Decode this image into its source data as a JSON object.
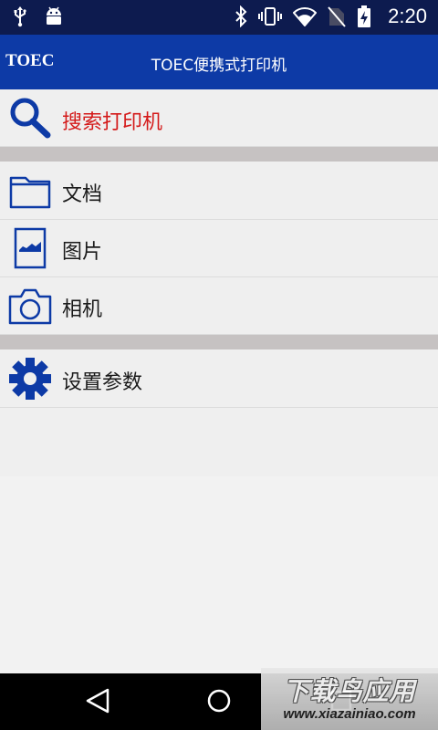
{
  "status_bar": {
    "time": "2:20",
    "left_icons": [
      "usb-icon",
      "android-icon"
    ],
    "right_icons": [
      "bluetooth-icon",
      "vibrate-icon",
      "wifi-icon",
      "no-sim-icon",
      "battery-charging-icon"
    ]
  },
  "app_bar": {
    "logo": "TOEC",
    "title": "TOEC便携式打印机",
    "color": "#0d3aa6"
  },
  "menu": {
    "search": {
      "label": "搜索打印机",
      "icon": "search-icon",
      "color": "#d41a1a"
    },
    "items": [
      {
        "label": "文档",
        "icon": "folder-icon"
      },
      {
        "label": "图片",
        "icon": "image-icon"
      },
      {
        "label": "相机",
        "icon": "camera-icon"
      }
    ],
    "settings": {
      "label": "设置参数",
      "icon": "gear-icon"
    }
  },
  "nav_bar": {
    "buttons": [
      "back-icon",
      "home-icon",
      "recents-icon"
    ]
  },
  "watermark": {
    "title": "下载鸟应用",
    "url": "www.xiazainiao.com"
  },
  "colors": {
    "status_bar": "#0d1b4f",
    "icon_blue": "#0d3aa6",
    "separator": "#c6c2c2"
  }
}
